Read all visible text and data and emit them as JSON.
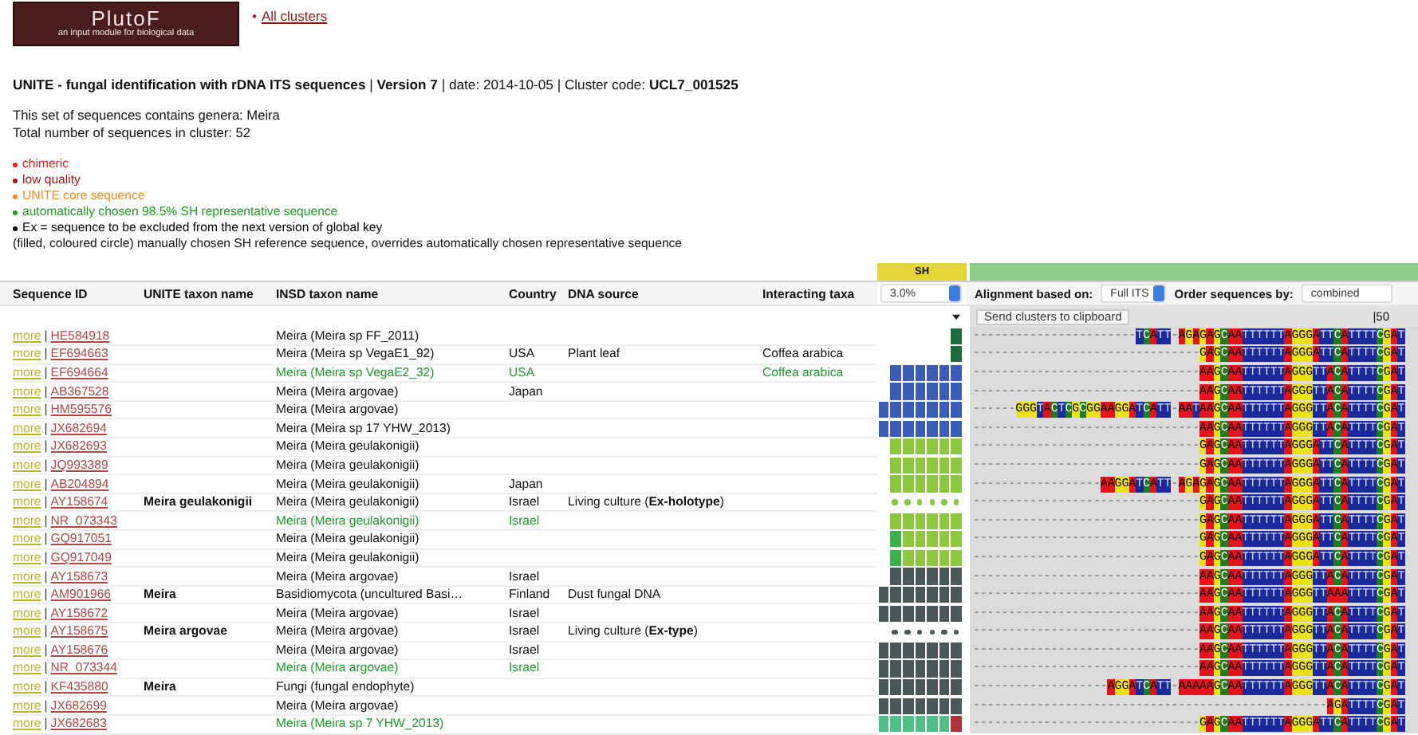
{
  "logo": {
    "name": "PlutoF",
    "tagline": "an input module for biological data"
  },
  "nav_link": {
    "bullet": "•",
    "label": "All clusters"
  },
  "title": "**UNITE - fungal identification with rDNA ITS sequences** | **Version 7** | date: 2014-10-05 | Cluster code: **UCL7_001525**",
  "summary": [
    "This set of sequences contains genera: Meira",
    "Total number of sequences in cluster: 52"
  ],
  "legend": [
    {
      "kind": "bullet",
      "text": "chimeric",
      "color": "#e02020"
    },
    {
      "kind": "bullet",
      "text": "low quality",
      "color": "#a01818"
    },
    {
      "kind": "bullet",
      "text": "UNITE core sequence",
      "color": "#f08c20"
    },
    {
      "kind": "bullet",
      "text": "automatically chosen 98.5% SH representative sequence",
      "color": "#229a22"
    },
    {
      "kind": "bullet",
      "text": "Ex = sequence to be excluded from the next version of global key",
      "color": "#000000"
    },
    {
      "kind": "note",
      "text": "(filled, coloured circle) manually chosen SH reference sequence, overrides automatically chosen representative sequence"
    }
  ],
  "sh_header": "SH",
  "columns": [
    "Sequence ID",
    "UNITE taxon name",
    "INSD taxon name",
    "Country",
    "DNA source",
    "Interacting taxa"
  ],
  "threshold_select": {
    "value": "3.0%"
  },
  "alignment_controls": {
    "based_on_label": "Alignment based on:",
    "based_on": "Full ITS",
    "order_label": "Order sequences by:",
    "order": "combined"
  },
  "clipboard_button": "Send clusters to clipboard",
  "ruler_mark": "|50",
  "rows": [
    {
      "more": "more",
      "sep": "|",
      "id": "HE584918",
      "insd": "Meira (Meira sp FF_2011)",
      "representative": false,
      "sh": {
        "kind": "block",
        "cells": [
          {
            "color": "#1e6b3c"
          }
        ]
      },
      "alignment": "-----------------------TCATT-AGAGAGCAATTTTTTAGGGATTCATTTTCGAT"
    },
    {
      "more": "more",
      "sep": "|",
      "id": "EF694663",
      "insd": "Meira (Meira sp VegaE1_92)",
      "country": "USA",
      "source": "Plant leaf",
      "taxa": "Coffea arabica",
      "representative": false,
      "sh": {
        "kind": "block",
        "cells": [
          {
            "color": "#1e6b3c"
          }
        ]
      },
      "alignment": "--------------------------------GAGCAATTTTTTAGGGATTCATTTTCGAT"
    },
    {
      "more": "more",
      "sep": "|",
      "id": "EF694664",
      "insd": "Meira (Meira sp VegaE2_32)",
      "country": "USA",
      "taxa": "Coffea arabica",
      "representative": true,
      "sh": {
        "kind": "block",
        "cells": [
          {
            "color": "#3b5db5"
          },
          {
            "color": "#3b5db5"
          },
          {
            "color": "#3b5db5"
          },
          {
            "color": "#3b5db5"
          },
          {
            "color": "#3b5db5"
          },
          {
            "color": "#3b5db5"
          }
        ]
      },
      "alignment": "--------------------------------AAGCAATTTTTTAGGGTTACATTTTCGAT"
    },
    {
      "more": "more",
      "sep": "|",
      "id": "AB367528",
      "insd": "Meira (Meira argovae)",
      "country": "Japan",
      "representative": false,
      "sh": {
        "kind": "block",
        "cells": [
          {
            "color": "#3b5db5"
          },
          {
            "color": "#3b5db5"
          },
          {
            "color": "#3b5db5"
          },
          {
            "color": "#3b5db5"
          },
          {
            "color": "#3b5db5"
          },
          {
            "color": "#3b5db5"
          }
        ]
      },
      "alignment": "--------------------------------AAGCAATTTTTTAGGGTTACATTTTCGAT"
    },
    {
      "more": "more",
      "sep": "|",
      "id": "HM595576",
      "insd": "Meira (Meira argovae)",
      "representative": false,
      "sh": {
        "kind": "block",
        "cells": [
          {
            "color": "#3b5db5"
          },
          {
            "color": "#3b5db5"
          },
          {
            "color": "#3b5db5"
          },
          {
            "color": "#3b5db5"
          },
          {
            "color": "#3b5db5"
          },
          {
            "color": "#3b5db5"
          },
          {
            "color": "#3b5db5"
          }
        ]
      },
      "alignment": "------GGGTACTCGCGGAAGGATCATT-AATAAGCAATTTTTTAGGGTTACATTTTCGAT"
    },
    {
      "more": "more",
      "sep": "|",
      "id": "JX682694",
      "insd": "Meira (Meira sp 17 YHW_2013)",
      "representative": false,
      "sh": {
        "kind": "block",
        "cells": [
          {
            "color": "#3b5db5"
          },
          {
            "color": "#3b5db5"
          },
          {
            "color": "#3b5db5"
          },
          {
            "color": "#3b5db5"
          },
          {
            "color": "#3b5db5"
          },
          {
            "color": "#3b5db5"
          },
          {
            "color": "#3b5db5"
          }
        ]
      },
      "alignment": "--------------------------------AAGCAATTTTTTAGGGTTACATTTTCGAT"
    },
    {
      "more": "more",
      "sep": "|",
      "id": "JX682693",
      "insd": "Meira (Meira geulakonigii)",
      "representative": false,
      "sh": {
        "kind": "block",
        "cells": [
          {
            "color": "#8dc63f"
          },
          {
            "color": "#8dc63f"
          },
          {
            "color": "#8dc63f"
          },
          {
            "color": "#8dc63f"
          },
          {
            "color": "#8dc63f"
          },
          {
            "color": "#8dc63f"
          }
        ]
      },
      "alignment": "--------------------------------GAGCAATTTTTTAGGGATTCATTTTCGAT"
    },
    {
      "more": "more",
      "sep": "|",
      "id": "JQ993389",
      "insd": "Meira (Meira geulakonigii)",
      "representative": false,
      "sh": {
        "kind": "block",
        "cells": [
          {
            "color": "#8dc63f"
          },
          {
            "color": "#8dc63f"
          },
          {
            "color": "#8dc63f"
          },
          {
            "color": "#8dc63f"
          },
          {
            "color": "#8dc63f"
          },
          {
            "color": "#8dc63f"
          }
        ]
      },
      "alignment": "--------------------------------GAGCAATTTTTTAGGGATTCATTTTCGAT"
    },
    {
      "more": "more",
      "sep": "|",
      "id": "AB204894",
      "insd": "Meira (Meira geulakonigii)",
      "country": "Japan",
      "representative": false,
      "sh": {
        "kind": "block",
        "cells": [
          {
            "color": "#8dc63f"
          },
          {
            "color": "#8dc63f"
          },
          {
            "color": "#8dc63f"
          },
          {
            "color": "#8dc63f"
          },
          {
            "color": "#8dc63f"
          },
          {
            "color": "#8dc63f"
          }
        ]
      },
      "alignment": "------------------AAGGATCATT-AGAGAGCAATTTTTTAGGGATTCATTTTCGAT"
    },
    {
      "more": "more",
      "sep": "|",
      "id": "AY158674",
      "unite": "Meira geulakonigii",
      "insd": "Meira (Meira geulakonigii)",
      "country": "Israel",
      "source": "Living culture (**Ex-holotype**)",
      "representative": false,
      "sh": {
        "kind": "dots",
        "cells": [
          {
            "color": "#8dc63f"
          },
          {
            "color": "#8dc63f"
          },
          {
            "color": "#8dc63f"
          },
          {
            "color": "#8dc63f"
          },
          {
            "color": "#8dc63f"
          },
          {
            "color": "#8dc63f"
          }
        ]
      },
      "alignment": "--------------------------------GAGCAATTTTTTAGGGATTCATTTTCGAT"
    },
    {
      "more": "more",
      "sep": "|",
      "id": "NR_073343",
      "insd": "Meira (Meira geulakonigii)",
      "country": "Israel",
      "representative": true,
      "sh": {
        "kind": "block",
        "cells": [
          {
            "color": "#8dc63f"
          },
          {
            "color": "#8dc63f"
          },
          {
            "color": "#8dc63f"
          },
          {
            "color": "#8dc63f"
          },
          {
            "color": "#8dc63f"
          },
          {
            "color": "#8dc63f"
          }
        ]
      },
      "alignment": "--------------------------------GAGCAATTTTTTAGGGATTCATTTTCGAT"
    },
    {
      "more": "more",
      "sep": "|",
      "id": "GQ917051",
      "insd": "Meira (Meira geulakonigii)",
      "representative": false,
      "sh": {
        "kind": "block",
        "cells": [
          {
            "color": "#3cb04a"
          },
          {
            "color": "#8dc63f"
          },
          {
            "color": "#8dc63f"
          },
          {
            "color": "#8dc63f"
          },
          {
            "color": "#8dc63f"
          },
          {
            "color": "#8dc63f"
          }
        ]
      },
      "alignment": "--------------------------------GAGCAATTTTTTAGGGATTCATTTTCGAT"
    },
    {
      "more": "more",
      "sep": "|",
      "id": "GQ917049",
      "insd": "Meira (Meira geulakonigii)",
      "representative": false,
      "sh": {
        "kind": "block",
        "cells": [
          {
            "color": "#3cb04a"
          },
          {
            "color": "#8dc63f"
          },
          {
            "color": "#8dc63f"
          },
          {
            "color": "#8dc63f"
          },
          {
            "color": "#8dc63f"
          },
          {
            "color": "#8dc63f"
          }
        ]
      },
      "alignment": "--------------------------------GAGCAATTTTTTAGGGATTCATTTTCGAT"
    },
    {
      "more": "more",
      "sep": "|",
      "id": "AY158673",
      "insd": "Meira (Meira argovae)",
      "country": "Israel",
      "representative": false,
      "sh": {
        "kind": "block",
        "cells": [
          {
            "color": "#4a5858"
          },
          {
            "color": "#4a5858"
          },
          {
            "color": "#4a5858"
          },
          {
            "color": "#4a5858"
          },
          {
            "color": "#4a5858"
          },
          {
            "color": "#4a5858"
          }
        ]
      },
      "alignment": "--------------------------------AAGCAATTTTTTAGGGTTACATTTTCGAT"
    },
    {
      "more": "more",
      "sep": "|",
      "id": "AM901966",
      "unite": "Meira",
      "insd": "Basidiomycota (uncultured Basi…",
      "country": "Finland",
      "source": "Dust fungal DNA",
      "representative": false,
      "sh": {
        "kind": "block",
        "cells": [
          {
            "color": "#4a5858"
          },
          {
            "color": "#4a5858"
          },
          {
            "color": "#4a5858"
          },
          {
            "color": "#4a5858"
          },
          {
            "color": "#4a5858"
          },
          {
            "color": "#4a5858"
          },
          {
            "color": "#4a5858"
          }
        ]
      },
      "alignment": "--------------------------------AAGCAATTTTTTAGGGTTAAATTTTCGAT"
    },
    {
      "more": "more",
      "sep": "|",
      "id": "AY158672",
      "insd": "Meira (Meira argovae)",
      "country": "Israel",
      "representative": false,
      "sh": {
        "kind": "block",
        "cells": [
          {
            "color": "#4a5858"
          },
          {
            "color": "#4a5858"
          },
          {
            "color": "#4a5858"
          },
          {
            "color": "#4a5858"
          },
          {
            "color": "#4a5858"
          },
          {
            "color": "#4a5858"
          },
          {
            "color": "#4a5858"
          }
        ]
      },
      "alignment": "--------------------------------AAGCAATTTTTTAGGGTTACATTTTCGAT"
    },
    {
      "more": "more",
      "sep": "|",
      "id": "AY158675",
      "unite": "Meira argovae",
      "insd": "Meira (Meira argovae)",
      "country": "Israel",
      "source": "Living culture (**Ex-type**)",
      "representative": false,
      "sh": {
        "kind": "dots",
        "cells": [
          {
            "color": "#4a5858"
          },
          {
            "color": "#4a5858"
          },
          {
            "color": "#4a5858"
          },
          {
            "color": "#4a5858"
          },
          {
            "color": "#4a5858"
          },
          {
            "color": "#4a5858"
          }
        ]
      },
      "alignment": "--------------------------------AAGCAATTTTTTAGGGTTACATTTTCGAT"
    },
    {
      "more": "more",
      "sep": "|",
      "id": "AY158676",
      "insd": "Meira (Meira argovae)",
      "country": "Israel",
      "representative": false,
      "sh": {
        "kind": "block",
        "cells": [
          {
            "color": "#4a5858"
          },
          {
            "color": "#4a5858"
          },
          {
            "color": "#4a5858"
          },
          {
            "color": "#4a5858"
          },
          {
            "color": "#4a5858"
          },
          {
            "color": "#4a5858"
          },
          {
            "color": "#4a5858"
          }
        ]
      },
      "alignment": "--------------------------------AAGCAATTTTTTAGGGTTACATTTTCGAT"
    },
    {
      "more": "more",
      "sep": "|",
      "id": "NR_073344",
      "insd": "Meira (Meira argovae)",
      "country": "Israel",
      "representative": true,
      "sh": {
        "kind": "block",
        "cells": [
          {
            "color": "#4a5858"
          },
          {
            "color": "#4a5858"
          },
          {
            "color": "#4a5858"
          },
          {
            "color": "#4a5858"
          },
          {
            "color": "#4a5858"
          },
          {
            "color": "#4a5858"
          },
          {
            "color": "#4a5858"
          }
        ]
      },
      "alignment": "--------------------------------AAGCAATTTTTTAGGGTTACATTTTCGAT"
    },
    {
      "more": "more",
      "sep": "|",
      "id": "KF435880",
      "unite": "Meira",
      "insd": "Fungi (fungal endophyte)",
      "representative": false,
      "sh": {
        "kind": "block",
        "cells": [
          {
            "color": "#4a5858"
          },
          {
            "color": "#4a5858"
          },
          {
            "color": "#4a5858"
          },
          {
            "color": "#4a5858"
          },
          {
            "color": "#4a5858"
          },
          {
            "color": "#4a5858"
          },
          {
            "color": "#4a5858"
          }
        ]
      },
      "alignment": "-------------------AGGATCATT-AAAAAGCAATTTTTTAGGGTTACATTTTCGAT"
    },
    {
      "more": "more",
      "sep": "|",
      "id": "JX682699",
      "insd": "Meira (Meira argovae)",
      "representative": false,
      "sh": {
        "kind": "block",
        "cells": [
          {
            "color": "#4a5858"
          },
          {
            "color": "#4a5858"
          },
          {
            "color": "#4a5858"
          },
          {
            "color": "#4a5858"
          },
          {
            "color": "#4a5858"
          },
          {
            "color": "#4a5858"
          },
          {
            "color": "#4a5858"
          }
        ]
      },
      "alignment": "--------------------------------------------------AGATTTTCGAT"
    },
    {
      "more": "more",
      "sep": "|",
      "id": "JX682683",
      "insd": "Meira (Meira sp 7 YHW_2013)",
      "representative": true,
      "sh": {
        "kind": "block",
        "cells": [
          {
            "color": "#4fbf85"
          },
          {
            "color": "#4fbf85"
          },
          {
            "color": "#4fbf85"
          },
          {
            "color": "#4fbf85"
          },
          {
            "color": "#4fbf85"
          },
          {
            "color": "#4fbf85"
          },
          {
            "color": "#b0303a"
          }
        ]
      },
      "alignment": "--------------------------------GAGCAATTTTTTAGGGATTCATTTTCGAT"
    }
  ]
}
